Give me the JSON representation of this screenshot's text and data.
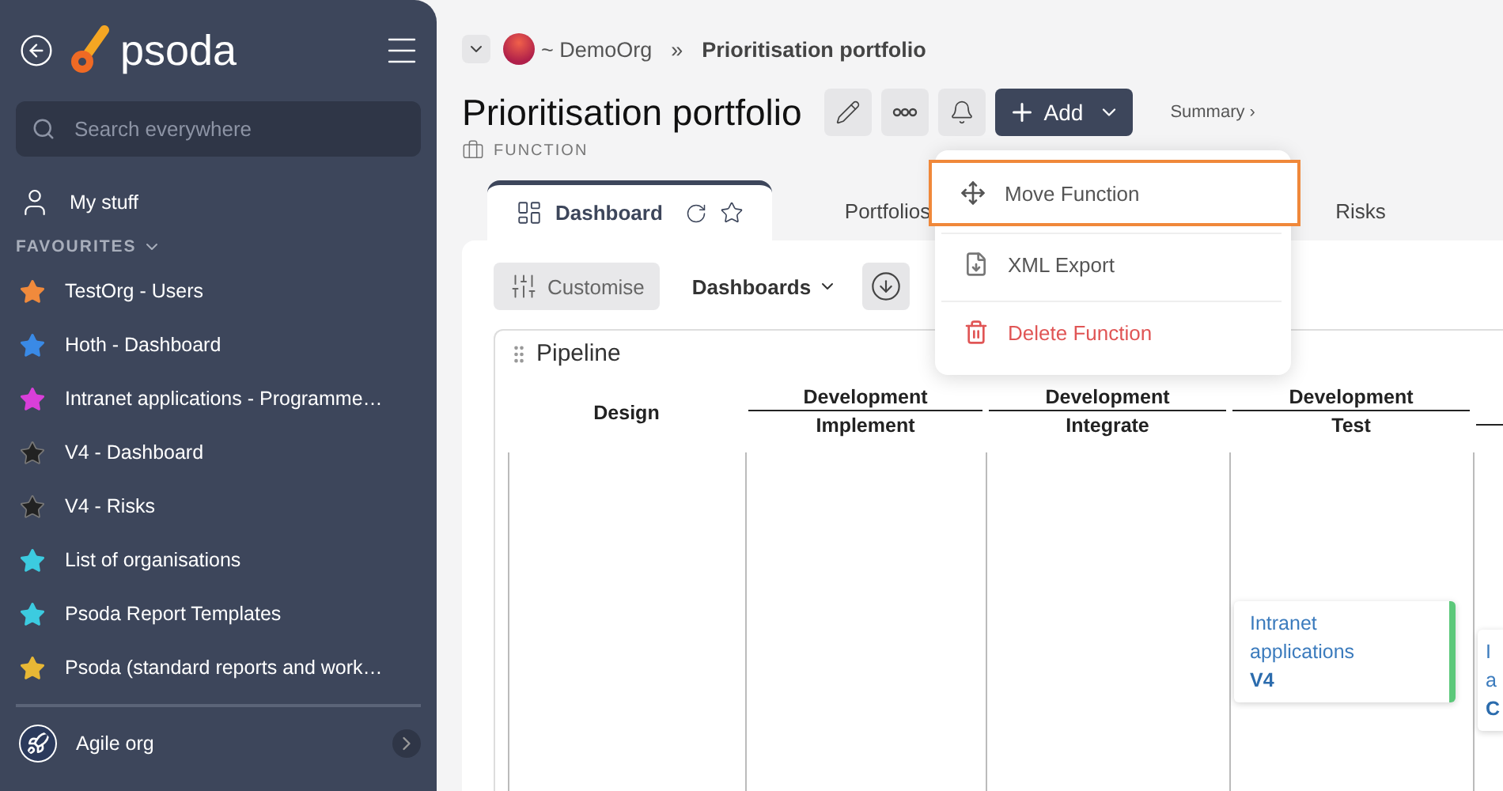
{
  "sidebar": {
    "logo": "psoda",
    "search": {
      "placeholder": "Search everywhere"
    },
    "my_stuff": "My stuff",
    "favourites": {
      "heading": "FAVOURITES",
      "expanded": true,
      "items": [
        {
          "label": "TestOrg - Users",
          "color": "#f08a3c"
        },
        {
          "label": "Hoth - Dashboard",
          "color": "#3a8ae6"
        },
        {
          "label": "Intranet applications - Programme…",
          "color": "#d93fd9"
        },
        {
          "label": "V4 - Dashboard",
          "color": "#222222"
        },
        {
          "label": "V4 - Risks",
          "color": "#222222"
        },
        {
          "label": "List of organisations",
          "color": "#3ccbe0"
        },
        {
          "label": "Psoda Report Templates",
          "color": "#3ccbe0"
        },
        {
          "label": "Psoda (standard reports and work…",
          "color": "#e8b835"
        }
      ]
    },
    "org": "Agile org"
  },
  "breadcrumb": {
    "org": "~ DemoOrg",
    "separator": "»",
    "current": "Prioritisation portfolio"
  },
  "title": "Prioritisation portfolio",
  "type_label": "FUNCTION",
  "actions": {
    "add": "Add",
    "summary": "Summary ›"
  },
  "tabs": [
    {
      "label": "Dashboard",
      "selected": true
    },
    {
      "label": "Portfolios",
      "selected": false
    },
    {
      "label": "Risks",
      "selected": false
    }
  ],
  "menu": {
    "items": [
      {
        "label": "Move Function",
        "kind": "move",
        "selected": true
      },
      {
        "label": "XML Export",
        "kind": "export",
        "selected": false
      },
      {
        "label": "Delete Function",
        "kind": "delete",
        "selected": false
      }
    ]
  },
  "toolbar": {
    "customise": "Customise",
    "dashboards": "Dashboards"
  },
  "pipeline": {
    "title": "Pipeline",
    "columns": [
      {
        "stage": "Design"
      },
      {
        "group": "Development",
        "stage": "Implement"
      },
      {
        "group": "Development",
        "stage": "Integrate"
      },
      {
        "group": "Development",
        "stage": "Test",
        "cards": [
          {
            "title_lines": [
              "Intranet",
              "applications"
            ],
            "code": "V4",
            "color": "#5cc87a"
          }
        ]
      },
      {
        "cards": [
          {
            "title_lines": [
              "I",
              "a"
            ],
            "code": "C"
          }
        ]
      }
    ]
  }
}
